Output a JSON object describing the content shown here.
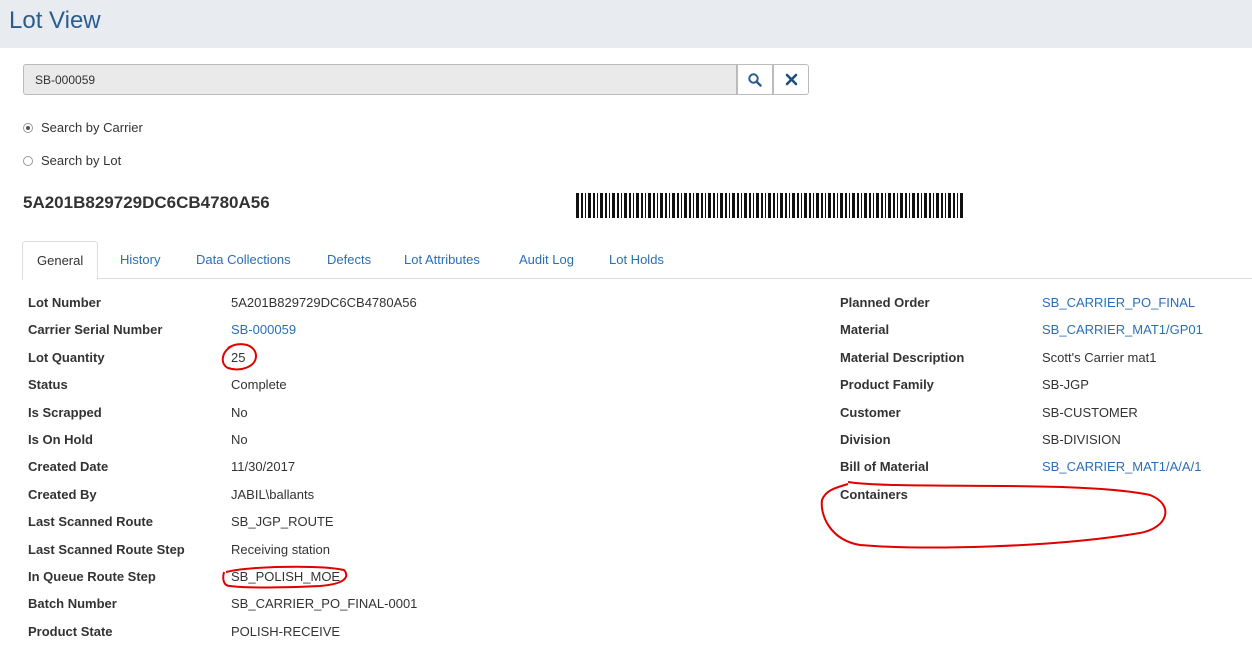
{
  "header": {
    "title": "Lot View"
  },
  "search": {
    "value": "SB-000059",
    "search_icon": "search-icon",
    "clear_icon": "close-icon"
  },
  "options": {
    "by_carrier": "Search by Carrier",
    "by_lot": "Search by Lot",
    "selected": "Search by Carrier"
  },
  "lot": {
    "id": "5A201B829729DC6CB4780A56"
  },
  "tabs": [
    {
      "label": "General",
      "active": true
    },
    {
      "label": "History"
    },
    {
      "label": "Data Collections"
    },
    {
      "label": "Defects"
    },
    {
      "label": "Lot Attributes"
    },
    {
      "label": "Audit Log"
    },
    {
      "label": "Lot Holds"
    }
  ],
  "left_fields": [
    {
      "label": "Lot Number",
      "value": "5A201B829729DC6CB4780A56"
    },
    {
      "label": "Carrier Serial Number",
      "value": "SB-000059",
      "link": true
    },
    {
      "label": "Lot Quantity",
      "value": "25"
    },
    {
      "label": "Status",
      "value": "Complete"
    },
    {
      "label": "Is Scrapped",
      "value": "No"
    },
    {
      "label": "Is On Hold",
      "value": "No"
    },
    {
      "label": "Created Date",
      "value": "11/30/2017"
    },
    {
      "label": "Created By",
      "value": "JABIL\\ballants"
    },
    {
      "label": "Last Scanned Route",
      "value": "SB_JGP_ROUTE"
    },
    {
      "label": "Last Scanned Route Step",
      "value": "Receiving station"
    },
    {
      "label": "In Queue Route Step",
      "value": "SB_POLISH_MOE"
    },
    {
      "label": "Batch Number",
      "value": "SB_CARRIER_PO_FINAL-0001"
    },
    {
      "label": "Product State",
      "value": "POLISH-RECEIVE"
    }
  ],
  "right_fields": [
    {
      "label": "Planned Order",
      "value": "SB_CARRIER_PO_FINAL",
      "link": true
    },
    {
      "label": "Material",
      "value": "SB_CARRIER_MAT1/GP01",
      "link": true
    },
    {
      "label": "Material Description",
      "value": "Scott's Carrier mat1"
    },
    {
      "label": "Product Family",
      "value": "SB-JGP"
    },
    {
      "label": "Customer",
      "value": "SB-CUSTOMER"
    },
    {
      "label": "Division",
      "value": "SB-DIVISION"
    },
    {
      "label": "Bill of Material",
      "value": "SB_CARRIER_MAT1/A/A/1",
      "link": true
    },
    {
      "label": "Containers",
      "value": ""
    }
  ],
  "colors": {
    "accent": "#2a6fb5",
    "title": "#2a5d8f",
    "annotation": "#e00000"
  }
}
